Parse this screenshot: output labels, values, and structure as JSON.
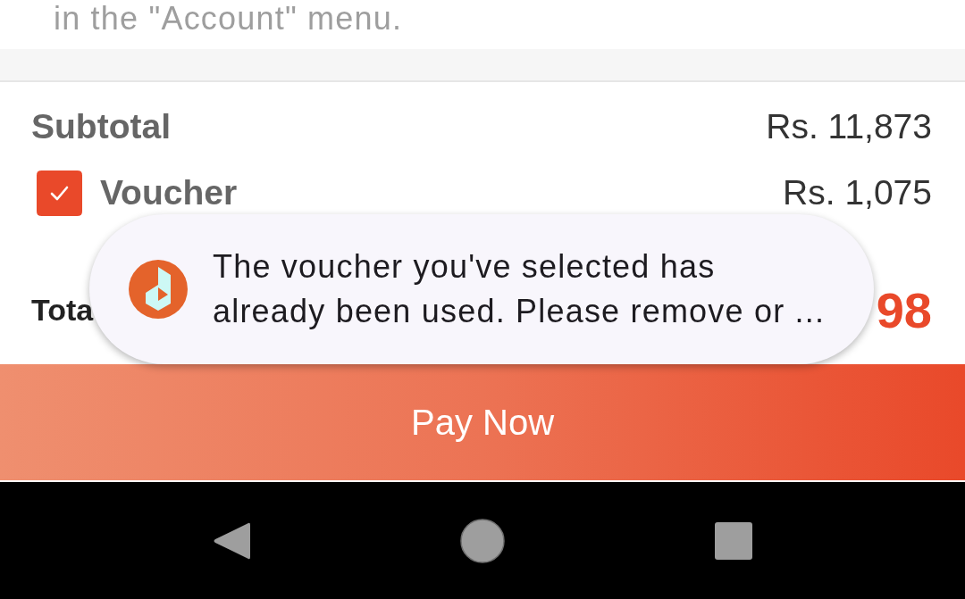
{
  "top_note": {
    "text": "in the \"Account\" menu."
  },
  "summary": {
    "subtotal": {
      "label": "Subtotal",
      "amount": "Rs. 11,873"
    },
    "voucher": {
      "label": "Voucher",
      "amount": "Rs. 1,075",
      "checked": true
    },
    "total": {
      "label": "Tota",
      "amount": "98"
    }
  },
  "pay_button": {
    "label": "Pay Now"
  },
  "toast": {
    "lines": [
      "The voucher you've selected has",
      "already been used. Please remove or ..."
    ]
  }
}
